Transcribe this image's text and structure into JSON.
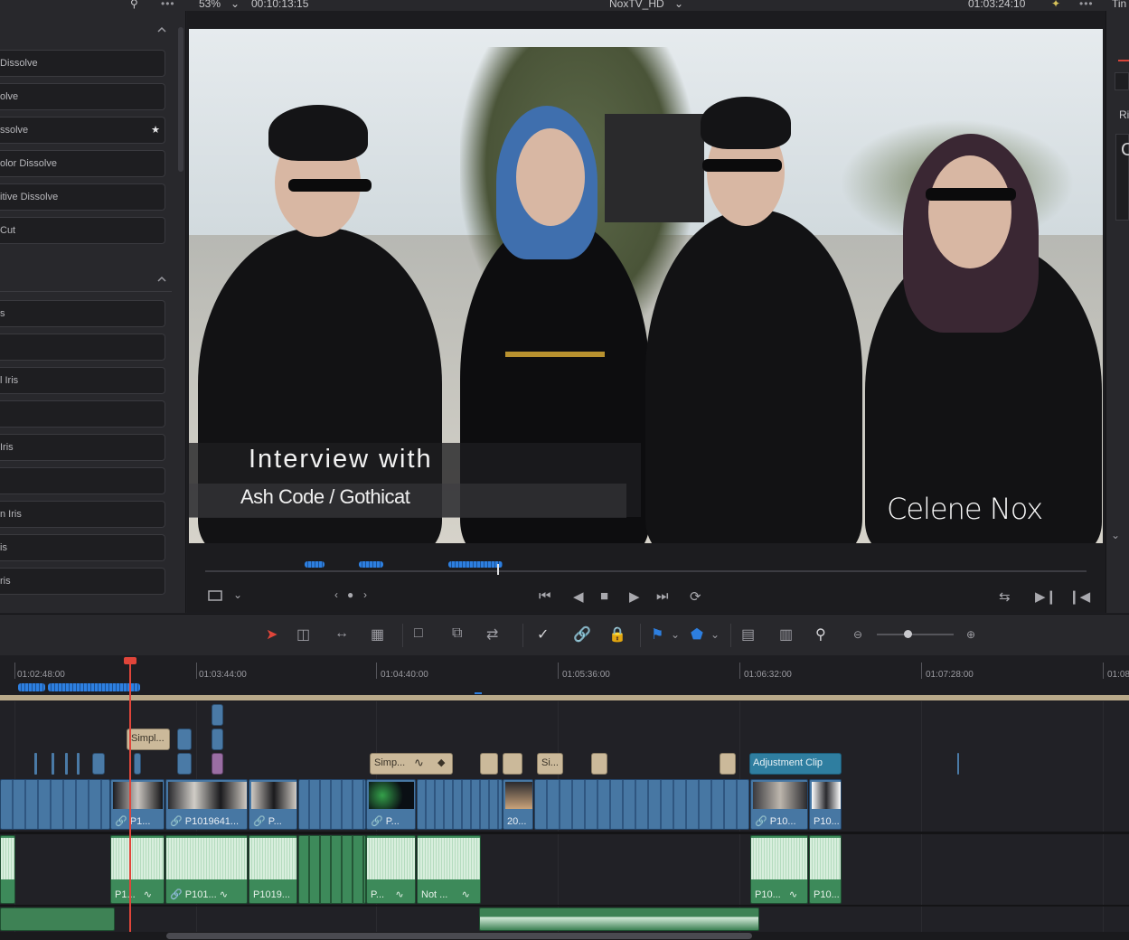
{
  "topbar": {
    "zoom": "53%",
    "source_timecode": "00:10:13:15",
    "timeline_name": "NoxTV_HD",
    "record_timecode": "01:03:24:10",
    "right_title_fragment": "Tin"
  },
  "effects_panel": {
    "group1_items": [
      {
        "label": "Dissolve"
      },
      {
        "label": "olve"
      },
      {
        "label": "ssolve",
        "favorite": true
      },
      {
        "label": "olor Dissolve"
      },
      {
        "label": "itive Dissolve"
      },
      {
        "label": "Cut"
      }
    ],
    "group2_items": [
      {
        "label": "s"
      },
      {
        "label": ""
      },
      {
        "label": "l Iris"
      },
      {
        "label": ""
      },
      {
        "label": " Iris"
      },
      {
        "label": ""
      },
      {
        "label": "n Iris"
      },
      {
        "label": "is"
      },
      {
        "label": "ris"
      }
    ]
  },
  "viewer": {
    "lower_third_title": "Interview with",
    "lower_third_subtitle": "Ash Code / Gothicat",
    "signature": "Celene Nox"
  },
  "inspector": {
    "tab_fragment": "Ri",
    "box_fragment": "C"
  },
  "timeline": {
    "timecodes": [
      "01:02:48:00",
      "01:03:44:00",
      "01:04:40:00",
      "01:05:36:00",
      "01:06:32:00",
      "01:07:28:00",
      "01:08"
    ],
    "title_clips": [
      {
        "label": "Simpl..."
      },
      {
        "label": "Simp..."
      },
      {
        "label": "Si..."
      }
    ],
    "adjustment_clip": "Adjustment Clip",
    "video_clips": [
      {
        "label": "P1..."
      },
      {
        "label": "P1019641..."
      },
      {
        "label": "P..."
      },
      {
        "label": "P..."
      },
      {
        "label": "20..."
      },
      {
        "label": "P10..."
      },
      {
        "label": "P10..."
      }
    ],
    "audio_clips": [
      {
        "label": "P1..."
      },
      {
        "label": "P101..."
      },
      {
        "label": "P1019..."
      },
      {
        "label": "P..."
      },
      {
        "label": "Not ..."
      },
      {
        "label": "P10..."
      },
      {
        "label": "P10..."
      }
    ]
  },
  "colors": {
    "accent_red": "#e0453a",
    "marker_blue": "#2d7fe0",
    "video_clip": "#4777a3",
    "audio_clip": "#3d8a5a",
    "title_clip": "#cbb99a",
    "adjustment_clip": "#2f7ea0"
  }
}
